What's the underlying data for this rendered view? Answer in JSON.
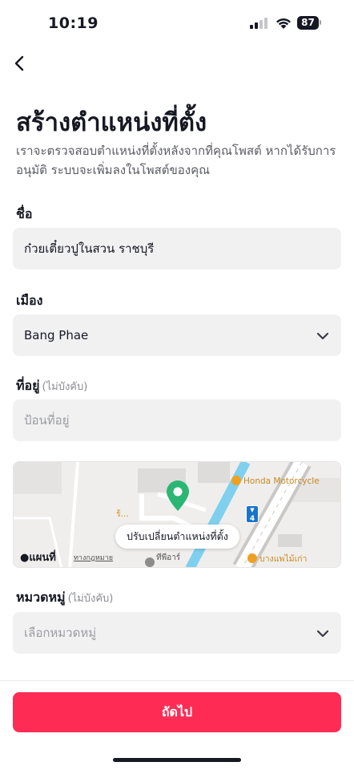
{
  "status_bar": {
    "time": "10:19",
    "battery": "87"
  },
  "header": {
    "title": "สร้างตำแหน่งที่ตั้ง",
    "subtitle": "เราจะตรวจสอบตำแหน่งที่ตั้งหลังจากที่คุณโพสต์ หากได้รับการอนุมัติ ระบบจะเพิ่มลงในโพสต์ของคุณ"
  },
  "form": {
    "name": {
      "label": "ชื่อ",
      "value": "ก๋วยเตี๋ยวปูในสวน ราชบุรี"
    },
    "city": {
      "label": "เมือง",
      "value": "Bang Phae"
    },
    "address": {
      "label": "ที่อยู่",
      "optional": "(ไม่บังคับ)",
      "placeholder": "ป้อนที่อยู่"
    },
    "category": {
      "label": "หมวดหมู่",
      "optional": "(ไม่บังคับ)",
      "placeholder": "เลือกหมวดหมู่"
    }
  },
  "map": {
    "adjust_label": "ปรับเปลี่ยนตำแหน่งที่ตั้ง",
    "poi_honda": "Honda Motorcycle",
    "poi_bangphae": "บางแพไม้เก่า",
    "poi_left": "ร้...",
    "place_bottom": "ทีพีอาร์",
    "logo_text": "แผนที่",
    "legal": "ทางกฎหมาย",
    "route_number": "4",
    "accent_color": "#2bb673"
  },
  "actions": {
    "next_label": "ถัดไป",
    "accent_color": "#fe2c55"
  }
}
